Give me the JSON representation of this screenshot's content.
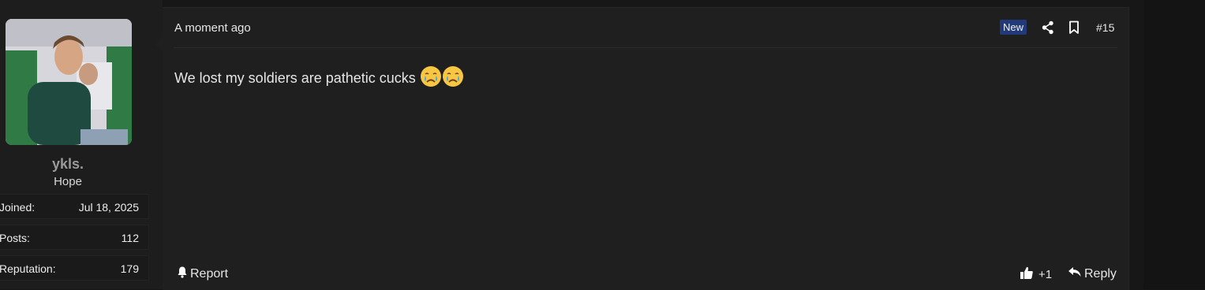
{
  "author": {
    "username": "ykls.",
    "title": "Hope",
    "stats": [
      {
        "label": "Joined:",
        "value": "Jul 18, 2025"
      },
      {
        "label": "Posts:",
        "value": "112"
      },
      {
        "label": "Reputation:",
        "value": "179"
      }
    ]
  },
  "post": {
    "timestamp": "A moment ago",
    "badge": "New",
    "number": "#15",
    "message": "We lost my soldiers are pathetic cucks",
    "emojis": [
      "crying-face-emoji",
      "crying-face-emoji"
    ]
  },
  "actions": {
    "report_label": "Report",
    "like_count": "+1",
    "reply_label": "Reply"
  },
  "colors": {
    "badge_bg": "#233a7a",
    "post_bg": "#1f1f1f",
    "page_bg": "#171717"
  }
}
